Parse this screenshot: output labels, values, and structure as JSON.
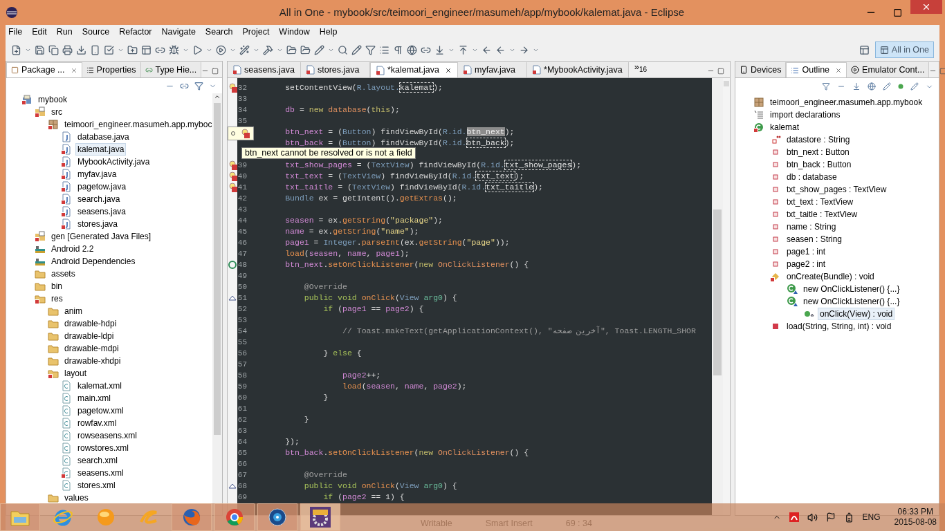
{
  "window": {
    "title": "All in One - mybook/src/teimoori_engineer/masumeh/app/mybook/kalemat.java - Eclipse"
  },
  "menu": [
    "File",
    "Edit",
    "Run",
    "Source",
    "Refactor",
    "Navigate",
    "Search",
    "Project",
    "Window",
    "Help"
  ],
  "perspective": {
    "label": "All in One",
    "selected": true
  },
  "left_panel": {
    "tabs": [
      {
        "label": "Package ...",
        "selected": true
      },
      {
        "label": "Properties",
        "selected": false
      },
      {
        "label": "Type Hie...",
        "selected": false
      }
    ],
    "tree": [
      {
        "label": "mybook",
        "kind": "project",
        "error": true,
        "selected": false,
        "children": [
          {
            "label": "src",
            "kind": "srcfolder",
            "error": true,
            "selected": false,
            "children": [
              {
                "label": "teimoori_engineer.masumeh.app.myboc",
                "kind": "package",
                "error": true,
                "selected": false,
                "children": [
                  {
                    "label": "database.java",
                    "kind": "java",
                    "error": false,
                    "selected": false
                  },
                  {
                    "label": "kalemat.java",
                    "kind": "java",
                    "error": true,
                    "selected": true
                  },
                  {
                    "label": "MybookActivity.java",
                    "kind": "java",
                    "error": true,
                    "selected": false
                  },
                  {
                    "label": "myfav.java",
                    "kind": "java",
                    "error": true,
                    "selected": false
                  },
                  {
                    "label": "pagetow.java",
                    "kind": "java",
                    "error": true,
                    "selected": false
                  },
                  {
                    "label": "search.java",
                    "kind": "java",
                    "error": true,
                    "selected": false
                  },
                  {
                    "label": "seasens.java",
                    "kind": "java",
                    "error": true,
                    "selected": false
                  },
                  {
                    "label": "stores.java",
                    "kind": "java",
                    "error": true,
                    "selected": false
                  }
                ]
              }
            ]
          },
          {
            "label": "gen [Generated Java Files]",
            "kind": "srcfolder",
            "error": true,
            "selected": false
          },
          {
            "label": "Android 2.2",
            "kind": "library",
            "error": false,
            "selected": false
          },
          {
            "label": "Android Dependencies",
            "kind": "library",
            "error": false,
            "selected": false
          },
          {
            "label": "assets",
            "kind": "folder",
            "error": false,
            "selected": false
          },
          {
            "label": "bin",
            "kind": "folder",
            "error": false,
            "selected": false
          },
          {
            "label": "res",
            "kind": "folder",
            "error": true,
            "selected": false,
            "children": [
              {
                "label": "anim",
                "kind": "folder",
                "error": false,
                "selected": false
              },
              {
                "label": "drawable-hdpi",
                "kind": "folder",
                "error": false,
                "selected": false
              },
              {
                "label": "drawable-ldpi",
                "kind": "folder",
                "error": false,
                "selected": false
              },
              {
                "label": "drawable-mdpi",
                "kind": "folder",
                "error": false,
                "selected": false
              },
              {
                "label": "drawable-xhdpi",
                "kind": "folder",
                "error": false,
                "selected": false
              },
              {
                "label": "layout",
                "kind": "folder",
                "error": true,
                "selected": false,
                "children": [
                  {
                    "label": "kalemat.xml",
                    "kind": "xml",
                    "error": false,
                    "selected": false
                  },
                  {
                    "label": "main.xml",
                    "kind": "xml",
                    "error": false,
                    "selected": false
                  },
                  {
                    "label": "pagetow.xml",
                    "kind": "xml",
                    "error": false,
                    "selected": false
                  },
                  {
                    "label": "rowfav.xml",
                    "kind": "xml",
                    "error": false,
                    "selected": false
                  },
                  {
                    "label": "rowseasens.xml",
                    "kind": "xml",
                    "error": false,
                    "selected": false
                  },
                  {
                    "label": "rowstores.xml",
                    "kind": "xml",
                    "error": false,
                    "selected": false
                  },
                  {
                    "label": "search.xml",
                    "kind": "xml",
                    "error": false,
                    "selected": false
                  },
                  {
                    "label": "seasens.xml",
                    "kind": "xml",
                    "error": true,
                    "selected": false
                  },
                  {
                    "label": "stores.xml",
                    "kind": "xml",
                    "error": false,
                    "selected": false
                  }
                ]
              },
              {
                "label": "values",
                "kind": "folder",
                "error": false,
                "selected": false
              }
            ]
          }
        ]
      }
    ]
  },
  "editor": {
    "tabs": [
      {
        "label": "seasens.java",
        "selected": false
      },
      {
        "label": "stores.java",
        "selected": false
      },
      {
        "label": "*kalemat.java",
        "selected": true
      },
      {
        "label": "myfav.java",
        "selected": false
      },
      {
        "label": "*MybookActivity.java",
        "selected": false
      }
    ],
    "overflow_mark": "»",
    "overflow_count": "16",
    "lines": [
      {
        "num": "32",
        "kind": "error",
        "tokens": [
          {
            "text": "        setContentView(",
            "kind": "plain"
          },
          {
            "text": "R.layout.",
            "kind": "type"
          },
          {
            "text": "kalemat",
            "kind": "occurrence"
          },
          {
            "text": ");",
            "kind": "plain"
          }
        ]
      },
      {
        "num": "33"
      },
      {
        "num": "34",
        "tokens": [
          {
            "text": "        db",
            "kind": "field"
          },
          {
            "text": " = ",
            "kind": "plain"
          },
          {
            "text": "new ",
            "kind": "literal"
          },
          {
            "text": "database",
            "kind": "class"
          },
          {
            "text": "(",
            "kind": "plain"
          },
          {
            "text": "this",
            "kind": "literal"
          },
          {
            "text": ");",
            "kind": "plain"
          }
        ]
      },
      {
        "num": "35"
      },
      {
        "tokens": [
          {
            "text": "        btn_next",
            "kind": "field"
          },
          {
            "text": " = (",
            "kind": "plain"
          },
          {
            "text": "Button",
            "kind": "type"
          },
          {
            "text": ") findViewById(",
            "kind": "plain"
          },
          {
            "text": "R.id.",
            "kind": "type"
          },
          {
            "text": "btn_next",
            "kind": "selection"
          },
          {
            "text": ");",
            "kind": "plain"
          }
        ]
      },
      {
        "tokens": [
          {
            "text": "        btn_back",
            "kind": "field"
          },
          {
            "text": " = (",
            "kind": "plain"
          },
          {
            "text": "Button",
            "kind": "type"
          },
          {
            "text": ") findViewById(",
            "kind": "plain"
          },
          {
            "text": "R.id.",
            "kind": "type"
          },
          {
            "text": "btn_back",
            "kind": "occurrence"
          },
          {
            "text": ");",
            "kind": "plain"
          }
        ]
      },
      {
        "tooltip": "btn_next cannot be resolved or is not a field"
      },
      {
        "num": "39",
        "kind": "error",
        "tokens": [
          {
            "text": "        txt_show_pages",
            "kind": "field"
          },
          {
            "text": " = (",
            "kind": "plain"
          },
          {
            "text": "TextView",
            "kind": "type"
          },
          {
            "text": ") findViewById(",
            "kind": "plain"
          },
          {
            "text": "R.id.",
            "kind": "type"
          },
          {
            "text": "txt_show_pages",
            "kind": "occurrence"
          },
          {
            "text": ");",
            "kind": "plain"
          }
        ]
      },
      {
        "num": "40",
        "kind": "error",
        "tokens": [
          {
            "text": "        txt_text",
            "kind": "field"
          },
          {
            "text": " = (",
            "kind": "plain"
          },
          {
            "text": "TextView",
            "kind": "type"
          },
          {
            "text": ") findViewById(",
            "kind": "plain"
          },
          {
            "text": "R.id.",
            "kind": "type"
          },
          {
            "text": "txt_text",
            "kind": "occurrence"
          },
          {
            "text": ");",
            "kind": "plain"
          }
        ]
      },
      {
        "num": "41",
        "kind": "error",
        "tokens": [
          {
            "text": "        txt_taitle",
            "kind": "field"
          },
          {
            "text": " = (",
            "kind": "plain"
          },
          {
            "text": "TextView",
            "kind": "type"
          },
          {
            "text": ") findViewById(",
            "kind": "plain"
          },
          {
            "text": "R.id.",
            "kind": "type"
          },
          {
            "text": "txt_taitle",
            "kind": "occurrence"
          },
          {
            "text": ");",
            "kind": "plain"
          }
        ]
      },
      {
        "num": "42",
        "tokens": [
          {
            "text": "        Bundle",
            "kind": "type"
          },
          {
            "text": " ex = getIntent().",
            "kind": "plain"
          },
          {
            "text": "getExtras",
            "kind": "method"
          },
          {
            "text": "();",
            "kind": "plain"
          }
        ]
      },
      {
        "num": "43"
      },
      {
        "num": "44",
        "tokens": [
          {
            "text": "        seasen",
            "kind": "field"
          },
          {
            "text": " = ex.",
            "kind": "plain"
          },
          {
            "text": "getString",
            "kind": "method"
          },
          {
            "text": "(",
            "kind": "plain"
          },
          {
            "text": "\"package\"",
            "kind": "string"
          },
          {
            "text": ");",
            "kind": "plain"
          }
        ]
      },
      {
        "num": "45",
        "tokens": [
          {
            "text": "        name",
            "kind": "field"
          },
          {
            "text": " = ex.",
            "kind": "plain"
          },
          {
            "text": "getString",
            "kind": "method"
          },
          {
            "text": "(",
            "kind": "plain"
          },
          {
            "text": "\"name\"",
            "kind": "string"
          },
          {
            "text": ");",
            "kind": "plain"
          }
        ]
      },
      {
        "num": "46",
        "tokens": [
          {
            "text": "        page1",
            "kind": "field"
          },
          {
            "text": " = ",
            "kind": "plain"
          },
          {
            "text": "Integer",
            "kind": "type"
          },
          {
            "text": ".",
            "kind": "plain"
          },
          {
            "text": "parseInt",
            "kind": "method"
          },
          {
            "text": "(ex.",
            "kind": "plain"
          },
          {
            "text": "getString",
            "kind": "method"
          },
          {
            "text": "(",
            "kind": "plain"
          },
          {
            "text": "\"page\"",
            "kind": "string"
          },
          {
            "text": "));",
            "kind": "plain"
          }
        ]
      },
      {
        "num": "47",
        "tokens": [
          {
            "text": "        load",
            "kind": "method"
          },
          {
            "text": "(",
            "kind": "plain"
          },
          {
            "text": "seasen",
            "kind": "field"
          },
          {
            "text": ", ",
            "kind": "plain"
          },
          {
            "text": "name",
            "kind": "field"
          },
          {
            "text": ", ",
            "kind": "plain"
          },
          {
            "text": "page1",
            "kind": "field"
          },
          {
            "text": ");",
            "kind": "plain"
          }
        ]
      },
      {
        "num": "48",
        "kind": "override",
        "tokens": [
          {
            "text": "        btn_next",
            "kind": "field"
          },
          {
            "text": ".",
            "kind": "plain"
          },
          {
            "text": "setOnClickListener",
            "kind": "method"
          },
          {
            "text": "(",
            "kind": "plain"
          },
          {
            "text": "new ",
            "kind": "literal"
          },
          {
            "text": "OnClickListener",
            "kind": "class"
          },
          {
            "text": "() {",
            "kind": "plain"
          }
        ]
      },
      {
        "num": "49"
      },
      {
        "num": "50",
        "tokens": [
          {
            "text": "            @Override",
            "kind": "comment"
          }
        ]
      },
      {
        "num": "51",
        "kind": "implements",
        "tokens": [
          {
            "text": "            public void ",
            "kind": "keyword"
          },
          {
            "text": "onClick",
            "kind": "method"
          },
          {
            "text": "(",
            "kind": "plain"
          },
          {
            "text": "View ",
            "kind": "type"
          },
          {
            "text": "arg0",
            "kind": "param"
          },
          {
            "text": ") {",
            "kind": "plain"
          }
        ]
      },
      {
        "num": "52",
        "tokens": [
          {
            "text": "                if",
            "kind": "keyword"
          },
          {
            "text": " (",
            "kind": "plain"
          },
          {
            "text": "page1",
            "kind": "field"
          },
          {
            "text": " == ",
            "kind": "plain"
          },
          {
            "text": "page2",
            "kind": "field"
          },
          {
            "text": ") {",
            "kind": "plain"
          }
        ]
      },
      {
        "num": "53"
      },
      {
        "num": "54",
        "tokens": [
          {
            "text": "                    // Toast.makeText(getApplicationContext(), \"آخرین صفحه\", Toast.LENGTH_SHOR",
            "kind": "comment"
          }
        ]
      },
      {
        "num": "55"
      },
      {
        "num": "56",
        "tokens": [
          {
            "text": "                } ",
            "kind": "plain"
          },
          {
            "text": "else",
            "kind": "keyword"
          },
          {
            "text": " {",
            "kind": "plain"
          }
        ]
      },
      {
        "num": "57"
      },
      {
        "num": "58",
        "tokens": [
          {
            "text": "                    page2",
            "kind": "field"
          },
          {
            "text": "++;",
            "kind": "plain"
          }
        ]
      },
      {
        "num": "59",
        "tokens": [
          {
            "text": "                    load",
            "kind": "method"
          },
          {
            "text": "(",
            "kind": "plain"
          },
          {
            "text": "seasen",
            "kind": "field"
          },
          {
            "text": ", ",
            "kind": "plain"
          },
          {
            "text": "name",
            "kind": "field"
          },
          {
            "text": ", ",
            "kind": "plain"
          },
          {
            "text": "page2",
            "kind": "field"
          },
          {
            "text": ");",
            "kind": "plain"
          }
        ]
      },
      {
        "num": "60",
        "tokens": [
          {
            "text": "                }",
            "kind": "plain"
          }
        ]
      },
      {
        "num": "61"
      },
      {
        "num": "62",
        "tokens": [
          {
            "text": "            }",
            "kind": "plain"
          }
        ]
      },
      {
        "num": "63"
      },
      {
        "num": "64",
        "tokens": [
          {
            "text": "        });",
            "kind": "plain"
          }
        ]
      },
      {
        "num": "65",
        "tokens": [
          {
            "text": "        btn_back",
            "kind": "field"
          },
          {
            "text": ".",
            "kind": "plain"
          },
          {
            "text": "setOnClickListener",
            "kind": "method"
          },
          {
            "text": "(",
            "kind": "plain"
          },
          {
            "text": "new ",
            "kind": "literal"
          },
          {
            "text": "OnClickListener",
            "kind": "class"
          },
          {
            "text": "() {",
            "kind": "plain"
          }
        ]
      },
      {
        "num": "66"
      },
      {
        "num": "67",
        "tokens": [
          {
            "text": "            @Override",
            "kind": "comment"
          }
        ]
      },
      {
        "num": "68",
        "kind": "implements",
        "tokens": [
          {
            "text": "            public void ",
            "kind": "keyword"
          },
          {
            "text": "onClick",
            "kind": "method"
          },
          {
            "text": "(",
            "kind": "plain"
          },
          {
            "text": "View ",
            "kind": "type"
          },
          {
            "text": "arg0",
            "kind": "param"
          },
          {
            "text": ") {",
            "kind": "plain"
          }
        ]
      },
      {
        "num": "69",
        "tokens": [
          {
            "text": "                if",
            "kind": "keyword"
          },
          {
            "text": " (",
            "kind": "plain"
          },
          {
            "text": "page2",
            "kind": "field"
          },
          {
            "text": " == 1) {",
            "kind": "plain"
          }
        ]
      }
    ]
  },
  "right_panel": {
    "tabs": [
      {
        "label": "Devices",
        "selected": false
      },
      {
        "label": "Outline",
        "selected": true
      },
      {
        "label": "Emulator Cont...",
        "selected": false
      }
    ],
    "outline": [
      {
        "label": "teimoori_engineer.masumeh.app.mybook",
        "kind": "package",
        "error": false,
        "selected": false
      },
      {
        "label": "import declarations",
        "kind": "imports",
        "error": false,
        "selected": false
      },
      {
        "label": "kalemat",
        "kind": "class",
        "error": true,
        "selected": false,
        "children": [
          {
            "label": "datastore : String",
            "kind": "static_field",
            "error": false,
            "selected": false
          },
          {
            "label": "btn_next : Button",
            "kind": "field",
            "error": false,
            "selected": false
          },
          {
            "label": "btn_back : Button",
            "kind": "field",
            "error": false,
            "selected": false
          },
          {
            "label": "db : database",
            "kind": "field",
            "error": false,
            "selected": false
          },
          {
            "label": "txt_show_pages : TextView",
            "kind": "field",
            "error": false,
            "selected": false
          },
          {
            "label": "txt_text : TextView",
            "kind": "field",
            "error": false,
            "selected": false
          },
          {
            "label": "txt_taitle : TextView",
            "kind": "field",
            "error": false,
            "selected": false
          },
          {
            "label": "name : String",
            "kind": "field",
            "error": false,
            "selected": false
          },
          {
            "label": "seasen : String",
            "kind": "field",
            "error": false,
            "selected": false
          },
          {
            "label": "page1 : int",
            "kind": "field",
            "error": false,
            "selected": false
          },
          {
            "label": "page2 : int",
            "kind": "field",
            "error": false,
            "selected": false
          },
          {
            "label": "onCreate(Bundle) : void",
            "kind": "protected_method",
            "error": true,
            "selected": false,
            "children": [
              {
                "label": "new OnClickListener() {...}",
                "kind": "anon_class",
                "error": false,
                "selected": false
              },
              {
                "label": "new OnClickListener() {...}",
                "kind": "anon_class",
                "error": false,
                "selected": false,
                "children": [
                  {
                    "label": "onClick(View) : void",
                    "kind": "public_method",
                    "error": false,
                    "selected": true
                  }
                ]
              }
            ]
          },
          {
            "label": "load(String, String, int) : void",
            "kind": "private_method",
            "error": false,
            "selected": false
          }
        ]
      }
    ]
  },
  "status_bar": [
    "Writable",
    "Smart Insert",
    "69 : 34"
  ],
  "taskbar": {
    "apps": [
      {
        "kind": "explorer",
        "running": true,
        "selected": false
      },
      {
        "kind": "ie",
        "running": false,
        "selected": false
      },
      {
        "kind": "orb",
        "running": false,
        "selected": false
      },
      {
        "kind": "swirl",
        "running": false,
        "selected": false
      },
      {
        "kind": "firefox",
        "running": true,
        "selected": false
      },
      {
        "kind": "chrome",
        "running": true,
        "selected": false
      },
      {
        "kind": "media",
        "running": true,
        "selected": false
      },
      {
        "kind": "eclipse",
        "running": true,
        "selected": true
      }
    ],
    "language": "ENG",
    "time": "06:33 PM",
    "date": "2015-08-08"
  }
}
